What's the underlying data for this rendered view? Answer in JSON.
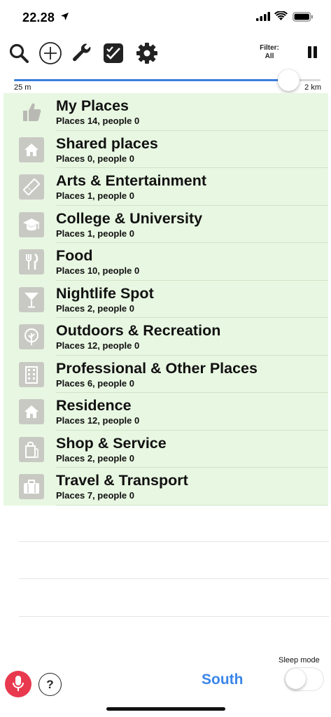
{
  "status": {
    "time": "22.28"
  },
  "toolbar": {
    "icons": [
      "search-icon",
      "add-icon",
      "wrench-icon",
      "checklist-icon",
      "gear-icon"
    ],
    "filter_label": "Filter:",
    "filter_value": "All"
  },
  "slider": {
    "min_label": "25 m",
    "max_label": "2 km",
    "value_fraction": 0.895,
    "accent": "#3b7ddd"
  },
  "categories": [
    {
      "title": "My Places",
      "subtitle": "Places 14, people 0",
      "icon": "thumbs-up-icon"
    },
    {
      "title": "Shared places",
      "subtitle": "Places 0, people 0",
      "icon": "house-icon"
    },
    {
      "title": "Arts & Entertainment",
      "subtitle": "Places 1, people 0",
      "icon": "ticket-icon"
    },
    {
      "title": "College & University",
      "subtitle": "Places 1, people 0",
      "icon": "graduation-cap-icon"
    },
    {
      "title": "Food",
      "subtitle": "Places 10, people 0",
      "icon": "fork-knife-icon"
    },
    {
      "title": "Nightlife Spot",
      "subtitle": "Places 2, people 0",
      "icon": "cocktail-glass-icon"
    },
    {
      "title": "Outdoors & Recreation",
      "subtitle": "Places 12, people 0",
      "icon": "tree-icon"
    },
    {
      "title": "Professional & Other Places",
      "subtitle": "Places 6, people 0",
      "icon": "office-building-icon"
    },
    {
      "title": "Residence",
      "subtitle": "Places 12, people 0",
      "icon": "house-icon"
    },
    {
      "title": "Shop & Service",
      "subtitle": "Places 2, people 0",
      "icon": "shopping-bag-icon"
    },
    {
      "title": "Travel & Transport",
      "subtitle": "Places 7, people 0",
      "icon": "suitcase-icon"
    }
  ],
  "bottom": {
    "help_label": "?",
    "direction": "South",
    "sleep_label": "Sleep mode",
    "sleep_on": false,
    "direction_color": "#3a86e8",
    "mic_color": "#e8394f"
  }
}
